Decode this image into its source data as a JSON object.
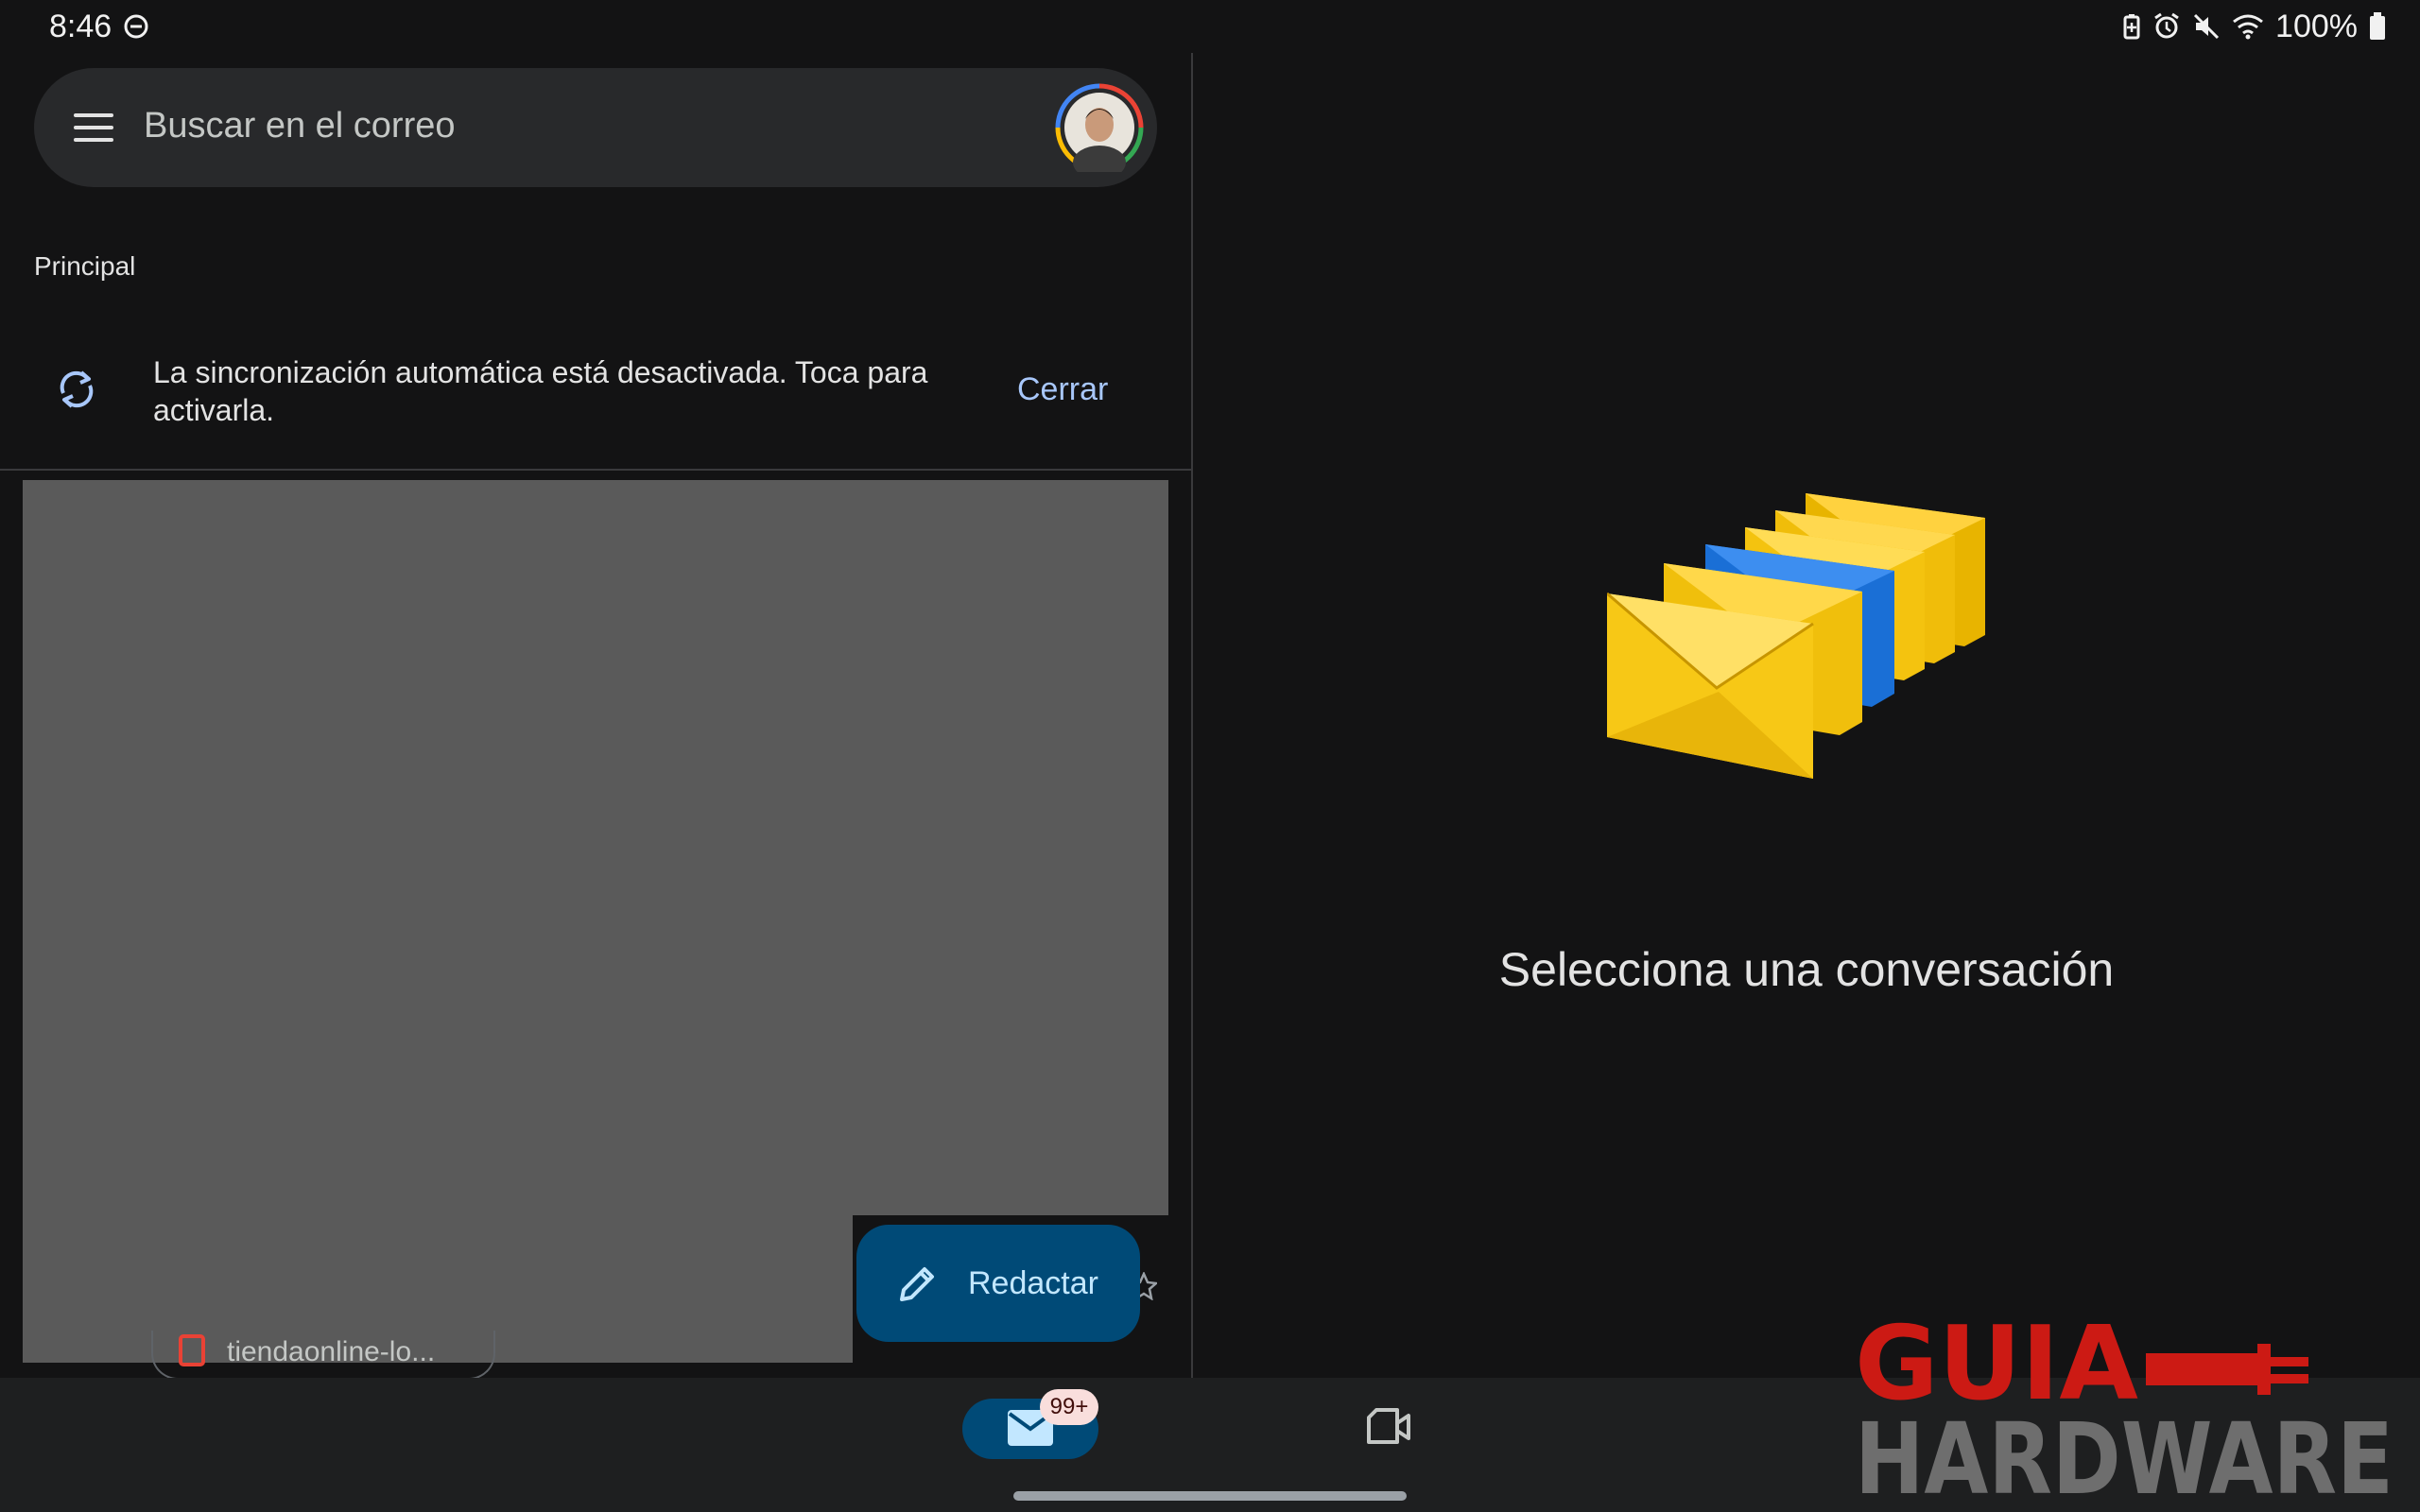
{
  "status_bar": {
    "time": "8:46",
    "battery": "100%",
    "icons": [
      "do-not-disturb-icon",
      "battery-saver-icon",
      "alarm-icon",
      "mute-icon",
      "wifi-icon",
      "battery-icon"
    ]
  },
  "search": {
    "placeholder": "Buscar en el correo",
    "menu_icon": "menu-icon",
    "avatar": "account-avatar"
  },
  "inbox": {
    "section_label": "Principal",
    "sync_banner": {
      "message": "La sincronización automática está desactivada. Toca para activarla.",
      "action": "Cerrar",
      "icon": "sync-icon"
    },
    "peek_item_text": "tiendaonline-lo..."
  },
  "compose": {
    "label": "Redactar",
    "icon": "pencil-icon"
  },
  "detail": {
    "empty_title": "Selecciona una conversación",
    "illustration": "envelopes-illustration"
  },
  "bottom_nav": {
    "mail_badge": "99+",
    "items": [
      "mail-icon",
      "meet-icon"
    ]
  },
  "watermark": {
    "line1": "GUIA",
    "line2": "HARDWARE"
  },
  "colors": {
    "background": "#131314",
    "surface": "#28292b",
    "accent": "#a8c7fa",
    "fab": "#004a77",
    "badge": "#f9dedc",
    "watermark_red": "#cc1a14",
    "watermark_gray": "#6e6e6e"
  }
}
